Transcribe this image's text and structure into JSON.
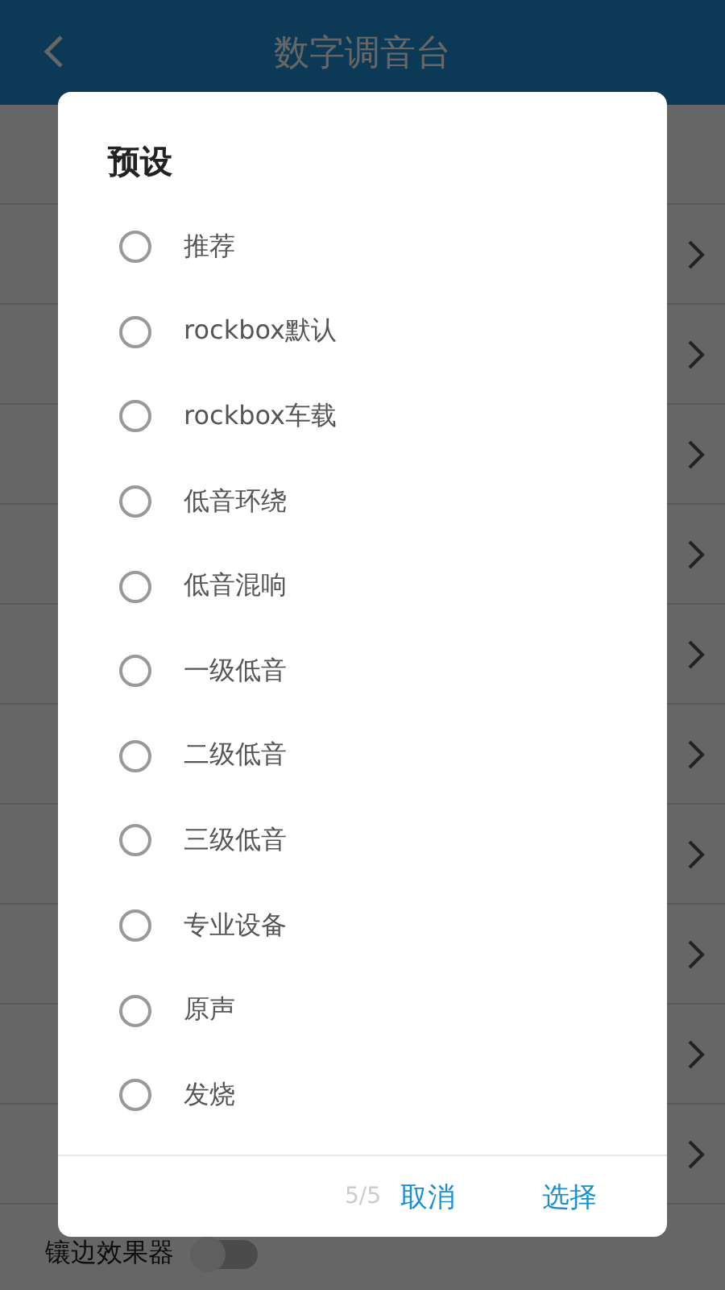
{
  "header": {
    "title": "数字调音台"
  },
  "settings_rows": [
    {
      "kind": "link"
    },
    {
      "kind": "link"
    },
    {
      "kind": "link"
    },
    {
      "kind": "link"
    },
    {
      "kind": "link"
    },
    {
      "kind": "link"
    },
    {
      "kind": "link"
    },
    {
      "kind": "link"
    },
    {
      "kind": "link"
    },
    {
      "kind": "link"
    },
    {
      "kind": "toggle",
      "label": "镶边效果器",
      "on": false
    }
  ],
  "dialog": {
    "title": "预设",
    "options": [
      {
        "label": "推荐",
        "selected": false
      },
      {
        "label": "rockbox默认",
        "selected": false
      },
      {
        "label": "rockbox车载",
        "selected": false
      },
      {
        "label": "低音环绕",
        "selected": false
      },
      {
        "label": "低音混响",
        "selected": false
      },
      {
        "label": "一级低音",
        "selected": false
      },
      {
        "label": "二级低音",
        "selected": false
      },
      {
        "label": "三级低音",
        "selected": false
      },
      {
        "label": "专业设备",
        "selected": false
      },
      {
        "label": "原声",
        "selected": false
      },
      {
        "label": "发烧",
        "selected": false
      }
    ],
    "page_indicator": "5/5",
    "buttons": [
      "取消",
      "选择"
    ]
  }
}
